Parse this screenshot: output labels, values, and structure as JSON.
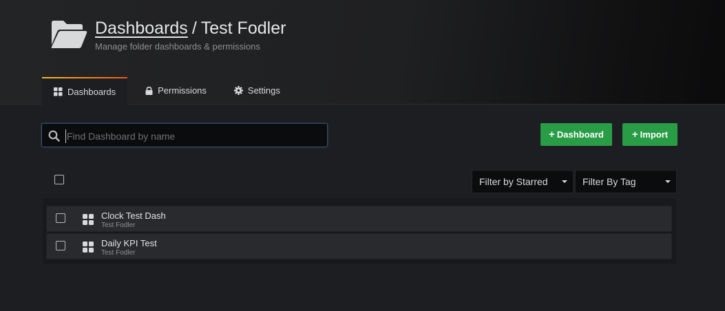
{
  "header": {
    "title_link": "Dashboards",
    "title_sep": "/",
    "title_folder": "Test Fodler",
    "subtitle": "Manage folder dashboards & permissions"
  },
  "tabs": [
    {
      "label": "Dashboards",
      "icon": "grid-icon",
      "active": true
    },
    {
      "label": "Permissions",
      "icon": "lock-icon",
      "active": false
    },
    {
      "label": "Settings",
      "icon": "gear-icon",
      "active": false
    }
  ],
  "search": {
    "placeholder": "Find Dashboard by name",
    "value": ""
  },
  "actions": {
    "dashboard_label": "Dashboard",
    "import_label": "Import",
    "plus": "+"
  },
  "filters": {
    "starred_label": "Filter by Starred",
    "tag_label": "Filter By Tag"
  },
  "dashboards": [
    {
      "name": "Clock Test Dash",
      "folder": "Test Fodler"
    },
    {
      "name": "Daily KPI Test",
      "folder": "Test Fodler"
    }
  ],
  "colors": {
    "primary_button": "#299c46",
    "tab_accent_start": "#fbbc1c",
    "tab_accent_end": "#f0551a"
  }
}
